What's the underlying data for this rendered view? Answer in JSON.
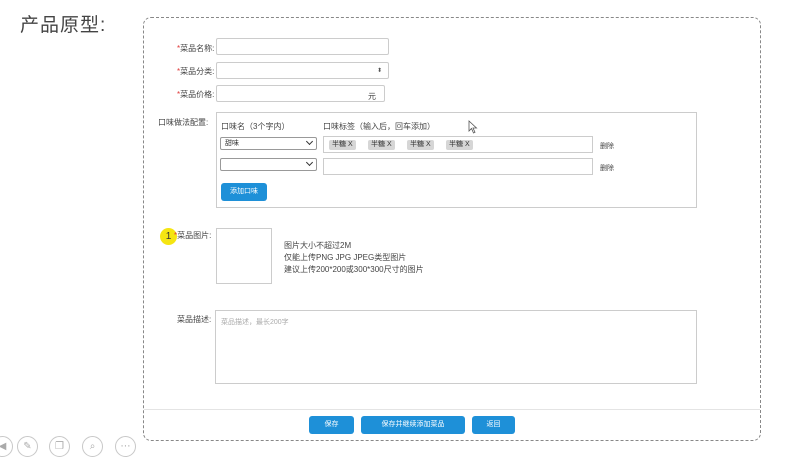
{
  "page_title": "产品原型:",
  "form": {
    "name_label": "菜品名称:",
    "category_label": "菜品分类:",
    "price_label": "菜品价格:",
    "price_unit": "元",
    "flavor_label": "口味做法配置:",
    "flavor_name_head": "口味名（3个字内）",
    "flavor_tag_head": "口味标签（输入后，回车添加）",
    "row1_select": "甜味",
    "row1_tags": [
      "半糖 X",
      "半糖 X",
      "半糖 X",
      "半糖 X"
    ],
    "row2_select": "",
    "delete_label": "删除",
    "add_flavor_button": "添加口味",
    "image_label": "菜品图片:",
    "image_hint_1": "图片大小不超过2M",
    "image_hint_2": "仅能上传PNG JPG JPEG类型图片",
    "image_hint_3": "建议上传200*200或300*300尺寸的图片",
    "desc_label": "菜品描述:",
    "desc_placeholder": "菜品描述，最长200字",
    "badge_number": "1"
  },
  "footer": {
    "save": "保存",
    "save_continue": "保存并继续添加菜品",
    "back": "返回"
  },
  "colors": {
    "primary": "#1e90d8",
    "required": "#e03b3b",
    "badge": "#f5e512"
  },
  "icons": [
    "back-circle-icon",
    "pen-icon",
    "copy-icon",
    "search-icon",
    "more-icon"
  ]
}
